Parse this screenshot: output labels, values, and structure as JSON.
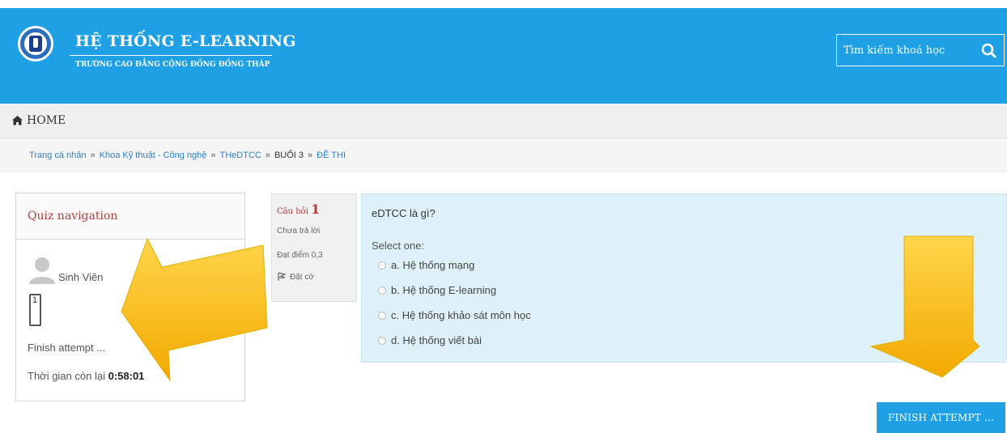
{
  "header": {
    "title": "HỆ THỐNG E-LEARNING",
    "subtitle": "TRƯỜNG CAO ĐẲNG CỘNG ĐỒNG ĐỒNG THÁP",
    "search_placeholder": "Tìm kiếm khoá học"
  },
  "nav": {
    "home_label": "HOME"
  },
  "breadcrumb": {
    "items": [
      "Trang cá nhân",
      "Khoa Kỹ thuật - Công nghệ",
      "THeDTCC",
      "BUỔI 3",
      "ĐỀ THI"
    ],
    "separator": "»"
  },
  "quiz_nav": {
    "title": "Quiz navigation",
    "user_name": "Sinh Viên",
    "question_button": "1",
    "finish_link": "Finish attempt ...",
    "timer_label": "Thời gian còn lại",
    "timer_value": "0:58:01"
  },
  "question": {
    "label": "Câu hỏi",
    "number": "1",
    "state": "Chưa trả lời",
    "mark": "Đạt điểm 0,3",
    "flag_label": "Đặt cờ",
    "text": "eDTCC là gì?",
    "prompt": "Select one:",
    "options": [
      "a. Hệ thống mạng",
      "b. Hệ thống E-learning",
      "c. Hệ thống khảo sát môn học",
      "d. Hệ thống viết bài"
    ]
  },
  "actions": {
    "finish_button": "FINISH ATTEMPT ..."
  },
  "colors": {
    "brand_blue": "#1fa0e4",
    "accent_red": "#b23c3c",
    "link_blue": "#2b7fc9",
    "question_bg": "#def0f8",
    "arrow_yellow": "#f5b400"
  }
}
